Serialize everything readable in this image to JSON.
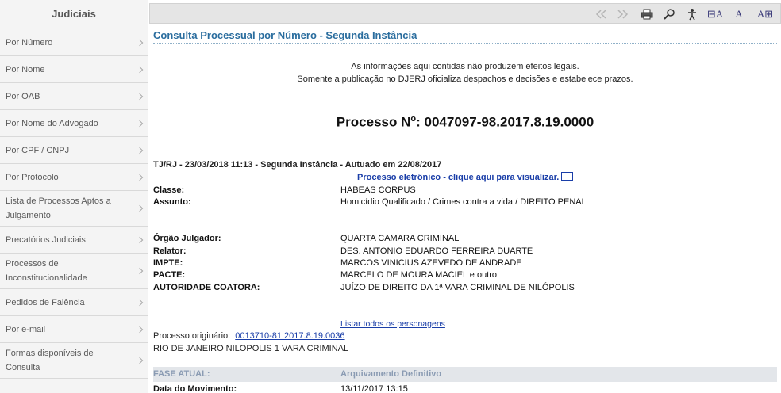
{
  "sidebar": {
    "title": "Judiciais",
    "items": [
      {
        "label": "Por Número"
      },
      {
        "label": "Por Nome"
      },
      {
        "label": "Por OAB"
      },
      {
        "label": "Por Nome do Advogado"
      },
      {
        "label": "Por CPF / CNPJ"
      },
      {
        "label": "Por Protocolo"
      },
      {
        "label": "Lista de Processos Aptos a Julgamento"
      },
      {
        "label": "Precatórios Judiciais"
      },
      {
        "label": "Processos de Inconstitucionalidade"
      },
      {
        "label": "Pedidos de Falência"
      },
      {
        "label": "Por e-mail"
      },
      {
        "label": "Formas disponíveis de Consulta"
      }
    ]
  },
  "toolbar": {
    "first_icon": "first-page-icon",
    "next_icon": "next-page-icon",
    "print_icon": "print-icon",
    "zoom_icon": "magnifier-icon",
    "accessibility_icon": "accessibility-icon",
    "font_decrease": "⊟A",
    "font_normal": "A",
    "font_increase": "A⊞"
  },
  "page": {
    "heading": "Consulta Processual por Número - Segunda Instância",
    "notice_line1": "As informações aqui contidas não produzem efeitos legais.",
    "notice_line2": "Somente a publicação no DJERJ oficializa despachos e decisões e estabelece prazos.",
    "process_prefix": "Processo N",
    "process_sup": "o",
    "process_number": ": 0047097-98.2017.8.19.0000",
    "header_line": "TJ/RJ - 23/03/2018 11:13 - Segunda Instância - Autuado em 22/08/2017",
    "electronic_link": "Processo eletrônico - clique aqui para visualizar.",
    "fields_top": [
      {
        "label": "Classe:",
        "value": "HABEAS CORPUS"
      },
      {
        "label": "Assunto:",
        "value": "Homicídio Qualificado / Crimes contra a vida / DIREITO PENAL"
      }
    ],
    "fields_parties": [
      {
        "label": "Órgão Julgador:",
        "value": "QUARTA CAMARA CRIMINAL"
      },
      {
        "label": "Relator:",
        "value": "DES. ANTONIO EDUARDO FERREIRA DUARTE"
      },
      {
        "label": "IMPTE:",
        "value": "MARCOS VINICIUS AZEVEDO DE ANDRADE"
      },
      {
        "label": "PACTE:",
        "value": "MARCELO DE MOURA MACIEL e outro"
      },
      {
        "label": "AUTORIDADE COATORA:",
        "value": "JUÍZO DE DIREITO DA 1ª VARA CRIMINAL DE NILÓPOLIS"
      }
    ],
    "list_link": "Listar todos os personagens",
    "origin_label": "Processo originário:",
    "origin_number": "0013710-81.2017.8.19.0036",
    "origin_court": "RIO DE JANEIRO NILOPOLIS 1 VARA CRIMINAL",
    "phase_label": "FASE ATUAL:",
    "phase_value": "Arquivamento Definitivo",
    "movement_label": "Data do Movimento:",
    "movement_value": "13/11/2017 13:15"
  }
}
